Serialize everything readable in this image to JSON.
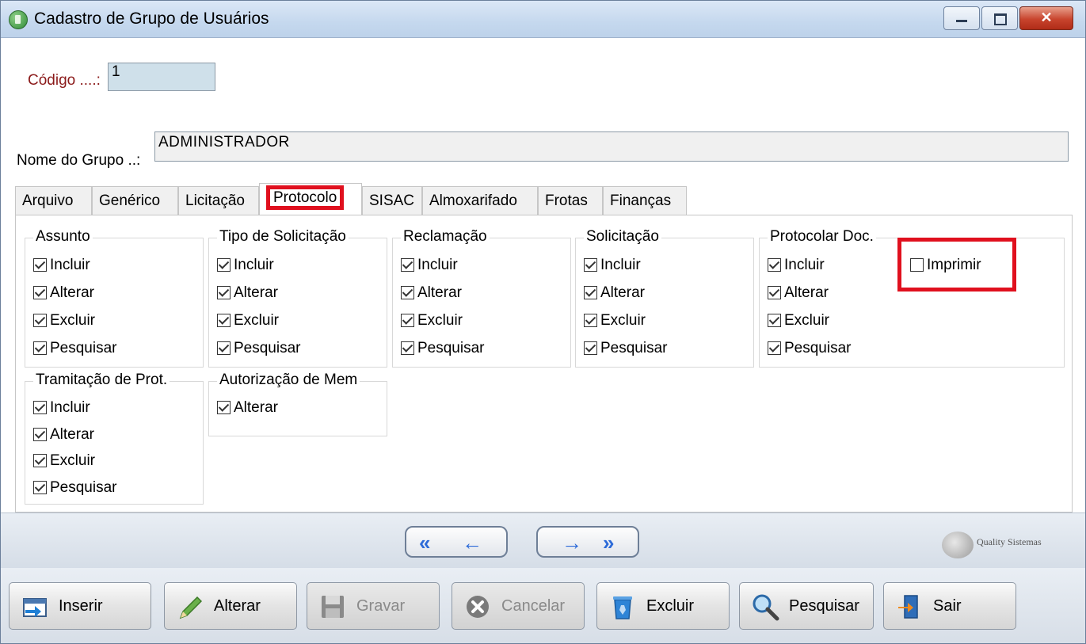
{
  "window": {
    "title": "Cadastro de Grupo de Usuários",
    "controls": {
      "minimize": "",
      "maximize": "",
      "close": "✕"
    }
  },
  "form": {
    "code_label": "Código ....:",
    "code_value": "1",
    "group_name_label": "Nome do Grupo ..:",
    "group_name_value": "ADMINISTRADOR"
  },
  "tabs": [
    {
      "label": "Arquivo"
    },
    {
      "label": "Genérico"
    },
    {
      "label": "Licitação"
    },
    {
      "label": "Protocolo",
      "active": true
    },
    {
      "label": "SISAC"
    },
    {
      "label": "Almoxarifado"
    },
    {
      "label": "Frotas"
    },
    {
      "label": "Finanças"
    }
  ],
  "groups": {
    "assunto": {
      "title": "Assunto",
      "items": [
        {
          "label": "Incluir",
          "checked": true
        },
        {
          "label": "Alterar",
          "checked": true
        },
        {
          "label": "Excluir",
          "checked": true
        },
        {
          "label": "Pesquisar",
          "checked": true
        }
      ]
    },
    "tipo_solicitacao": {
      "title": "Tipo de Solicitação",
      "items": [
        {
          "label": "Incluir",
          "checked": true
        },
        {
          "label": "Alterar",
          "checked": true
        },
        {
          "label": "Excluir",
          "checked": true
        },
        {
          "label": "Pesquisar",
          "checked": true
        }
      ]
    },
    "reclamacao": {
      "title": "Reclamação",
      "items": [
        {
          "label": "Incluir",
          "checked": true
        },
        {
          "label": "Alterar",
          "checked": true
        },
        {
          "label": "Excluir",
          "checked": true
        },
        {
          "label": "Pesquisar",
          "checked": true
        }
      ]
    },
    "solicitacao": {
      "title": "Solicitação",
      "items": [
        {
          "label": "Incluir",
          "checked": true
        },
        {
          "label": "Alterar",
          "checked": true
        },
        {
          "label": "Excluir",
          "checked": true
        },
        {
          "label": "Pesquisar",
          "checked": true
        }
      ]
    },
    "protocolar_doc": {
      "title": "Protocolar Doc.",
      "items": [
        {
          "label": "Incluir",
          "checked": true
        },
        {
          "label": "Alterar",
          "checked": true
        },
        {
          "label": "Excluir",
          "checked": true
        },
        {
          "label": "Pesquisar",
          "checked": true
        },
        {
          "label": "Imprimir",
          "checked": false
        }
      ]
    },
    "tramitacao": {
      "title": "Tramitação de Prot.",
      "items": [
        {
          "label": "Incluir",
          "checked": true
        },
        {
          "label": "Alterar",
          "checked": true
        },
        {
          "label": "Excluir",
          "checked": true
        },
        {
          "label": "Pesquisar",
          "checked": true
        }
      ]
    },
    "autorizacao": {
      "title": "Autorização de Mem",
      "items": [
        {
          "label": "Alterar",
          "checked": true
        }
      ]
    }
  },
  "navigation": {
    "first": "«",
    "prev": "←",
    "next": "→",
    "last": "»"
  },
  "logo": {
    "text": "Quality Sistemas"
  },
  "toolbar": {
    "insert": "Inserir",
    "edit": "Alterar",
    "save": "Gravar",
    "cancel": "Cancelar",
    "delete": "Excluir",
    "search": "Pesquisar",
    "exit": "Sair"
  },
  "colors": {
    "highlight": "#e0101e",
    "label_red": "#8b1a1a",
    "code_field_bg": "#cfe0ea"
  }
}
